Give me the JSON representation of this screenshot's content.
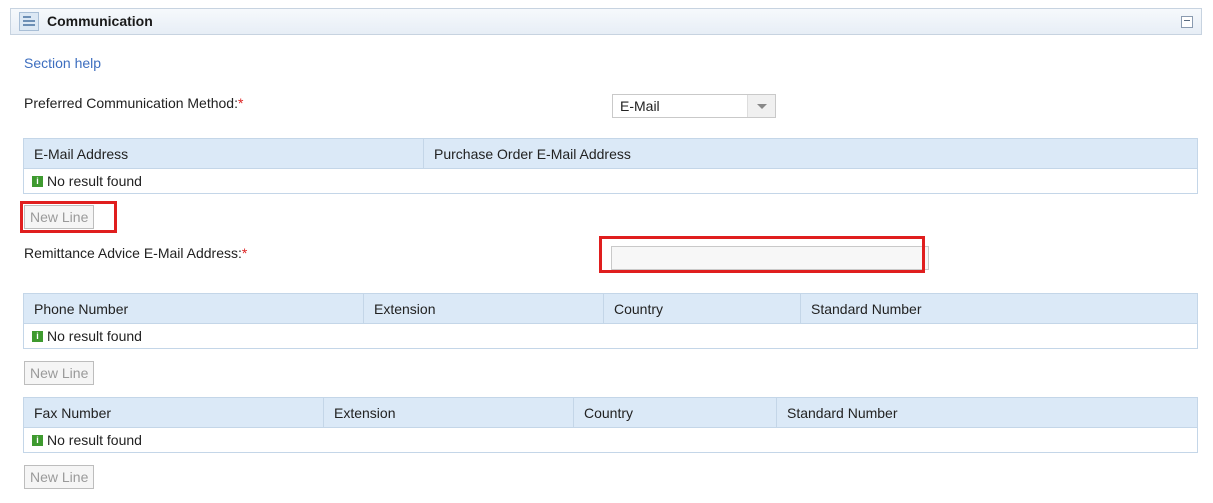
{
  "section": {
    "title": "Communication",
    "help_link": "Section help"
  },
  "preferred": {
    "label": "Preferred Communication Method:",
    "required_mark": "*",
    "value": "E-Mail"
  },
  "email_table": {
    "columns": [
      "E-Mail Address",
      "Purchase Order E-Mail Address"
    ],
    "empty_message": "No result found",
    "new_line_label": "New Line"
  },
  "remittance": {
    "label": "Remittance Advice E-Mail Address:",
    "required_mark": "*",
    "value": ""
  },
  "phone_table": {
    "columns": [
      "Phone Number",
      "Extension",
      "Country",
      "Standard Number"
    ],
    "empty_message": "No result found",
    "new_line_label": "New Line"
  },
  "fax_table": {
    "columns": [
      "Fax Number",
      "Extension",
      "Country",
      "Standard Number"
    ],
    "empty_message": "No result found",
    "new_line_label": "New Line"
  },
  "icons": {
    "info": "i"
  },
  "colors": {
    "header_bg": "#dbe9f7",
    "link": "#3d6ebf",
    "required": "#dd2222",
    "highlight": "#e01e1e",
    "info_icon": "#3e9a2f"
  }
}
